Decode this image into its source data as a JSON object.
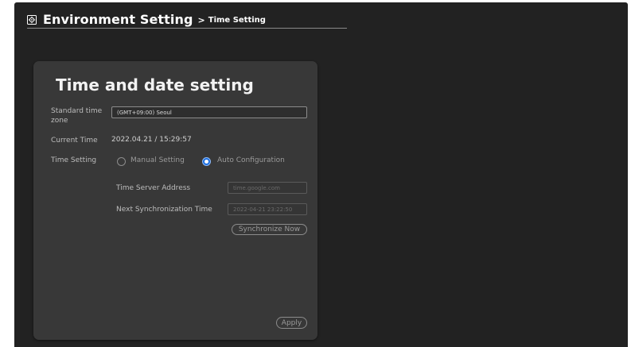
{
  "header": {
    "title": "Environment Setting",
    "separator": ">",
    "subtitle": "Time Setting",
    "icon": "gear-icon"
  },
  "panel": {
    "title": "Time and date setting",
    "timezone": {
      "label": "Standard time zone",
      "value": "(GMT+09:00) Seoul"
    },
    "current_time": {
      "label": "Current Time",
      "value": "2022.04.21 / 15:29:57"
    },
    "time_setting": {
      "label": "Time Setting",
      "options": [
        {
          "label": "Manual Setting",
          "selected": false
        },
        {
          "label": "Auto Configuration",
          "selected": true
        }
      ]
    },
    "time_server": {
      "label": "Time Server Address",
      "placeholder": "time.google.com"
    },
    "next_sync": {
      "label": "Next Synchronization Time",
      "placeholder": "2022-04-21 23:22:50"
    },
    "sync_button": "Synchronize Now",
    "apply_button": "Apply"
  },
  "colors": {
    "background": "#222222",
    "panel": "#383838",
    "accent": "#1d6fe0"
  }
}
